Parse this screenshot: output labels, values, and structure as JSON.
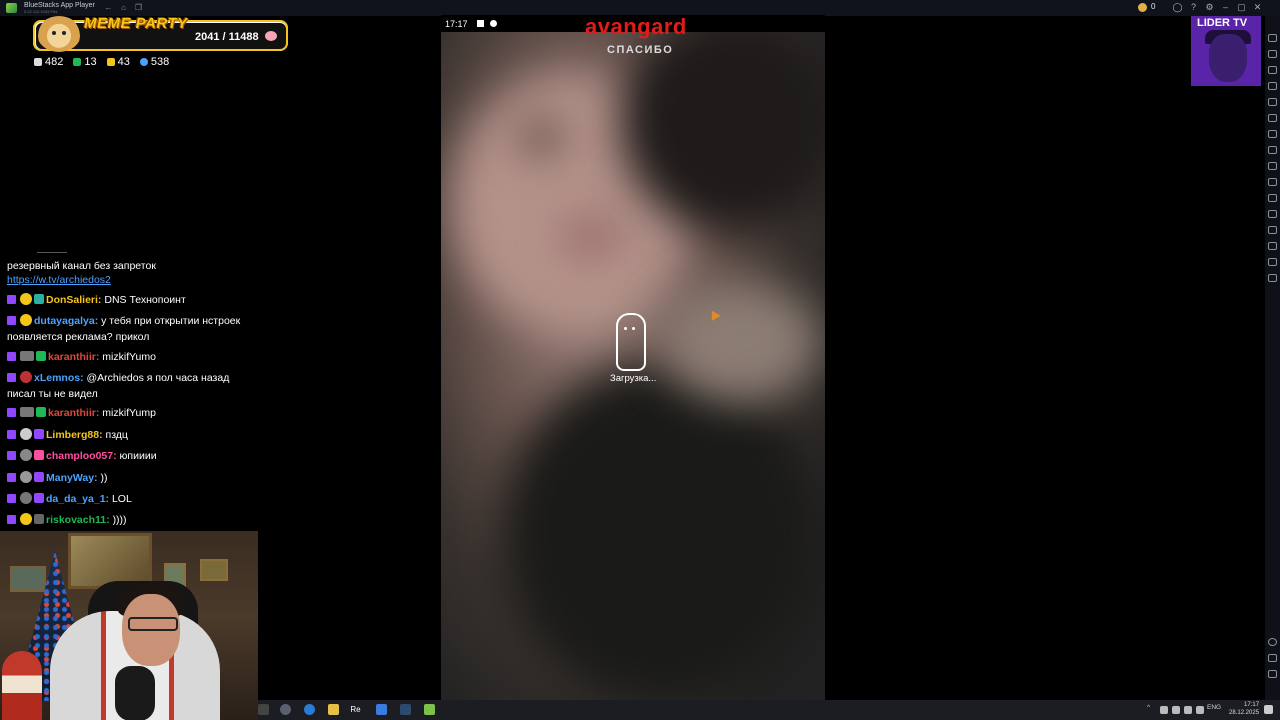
{
  "window": {
    "title": "BlueStacks App Player",
    "subtitle": "5.22.112.1003 P64",
    "coins": "0"
  },
  "overlay": {
    "meme_title": "MEME PARTY",
    "meme_progress": "2041 / 11488",
    "stats": [
      {
        "icon": "chat-bubble-icon",
        "value": "482",
        "color": "#ffffff"
      },
      {
        "icon": "k-icon",
        "value": "13",
        "color": "#1db954"
      },
      {
        "icon": "flag-icon",
        "value": "43",
        "color": "#f5c518"
      },
      {
        "icon": "person-icon",
        "value": "538",
        "color": "#4ba3ff"
      }
    ]
  },
  "chat": {
    "header_text": "резервный канал без запреток",
    "header_link": "https://w.tv/archiedos2",
    "messages": [
      {
        "user": "DonSalieri:",
        "color": "#f5c518",
        "text": "DNS Технопоинт"
      },
      {
        "user": "dutayagalya:",
        "color": "#4ba3ff",
        "text": "у тебя при открытии нстроек появляется реклама? прикол"
      },
      {
        "user": "karanthiir:",
        "color": "#e0473a",
        "text": "mizkifYumo"
      },
      {
        "user": "xLemnos:",
        "color": "#4ba3ff",
        "text": "@Archiedos я пол часа назад писал ты не видел"
      },
      {
        "user": "karanthiir:",
        "color": "#e0473a",
        "text": "mizkifYump"
      },
      {
        "user": "Limberg88:",
        "color": "#f5c518",
        "text": "пздц"
      },
      {
        "user": "champloo057:",
        "color": "#ff4fa0",
        "text": "юпииии"
      },
      {
        "user": "ManyWay:",
        "color": "#4ba3ff",
        "text": "))"
      },
      {
        "user": "da_da_ya_1:",
        "color": "#4ba3ff",
        "text": "LOL"
      },
      {
        "user": "riskovach11:",
        "color": "#1db954",
        "text": "))))"
      }
    ]
  },
  "phone": {
    "time": "17:17",
    "brand": "avangard",
    "brand_sub": "СПАСИБО",
    "loading_text": "Загрузка..."
  },
  "channel_logo": "LIDER TV",
  "taskbar": {
    "re_label": "Re",
    "lang": "ENG",
    "clock_time": "17:17",
    "clock_date": "28.12.2025"
  }
}
